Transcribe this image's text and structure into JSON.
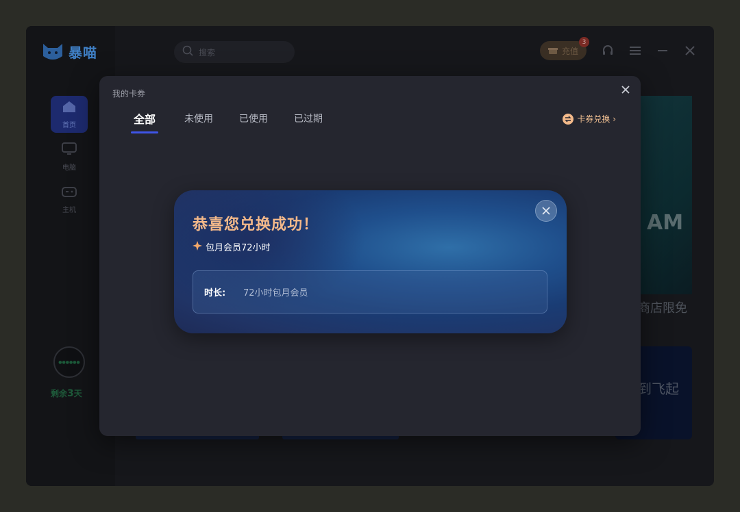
{
  "app": {
    "logo_text": "暴喵",
    "search_placeholder": "搜索",
    "recharge_label": "充值",
    "notification_count": "3",
    "nav": [
      {
        "label": "首页"
      },
      {
        "label": "电脑"
      },
      {
        "label": "主机"
      }
    ],
    "remain_prefix": "剩余",
    "remain_days": "3",
    "remain_suffix": "天",
    "banner_caption": "商店限免",
    "banner_big_text": "AM",
    "banner2_text": "到飞起"
  },
  "dialog": {
    "title": "我的卡券",
    "tabs": [
      {
        "label": "全部",
        "active": true
      },
      {
        "label": "未使用",
        "active": false
      },
      {
        "label": "已使用",
        "active": false
      },
      {
        "label": "已过期",
        "active": false
      }
    ],
    "redeem_label": "卡券兑换 ›"
  },
  "popup": {
    "title": "恭喜您兑换成功！",
    "subtitle": "包月会员72小时",
    "detail_key": "时长:",
    "detail_value": "72小时包月会员"
  },
  "colors": {
    "accent_blue": "#3f55e8",
    "title_orange": "#f4b98a",
    "redeem_orange": "#f3c193"
  }
}
